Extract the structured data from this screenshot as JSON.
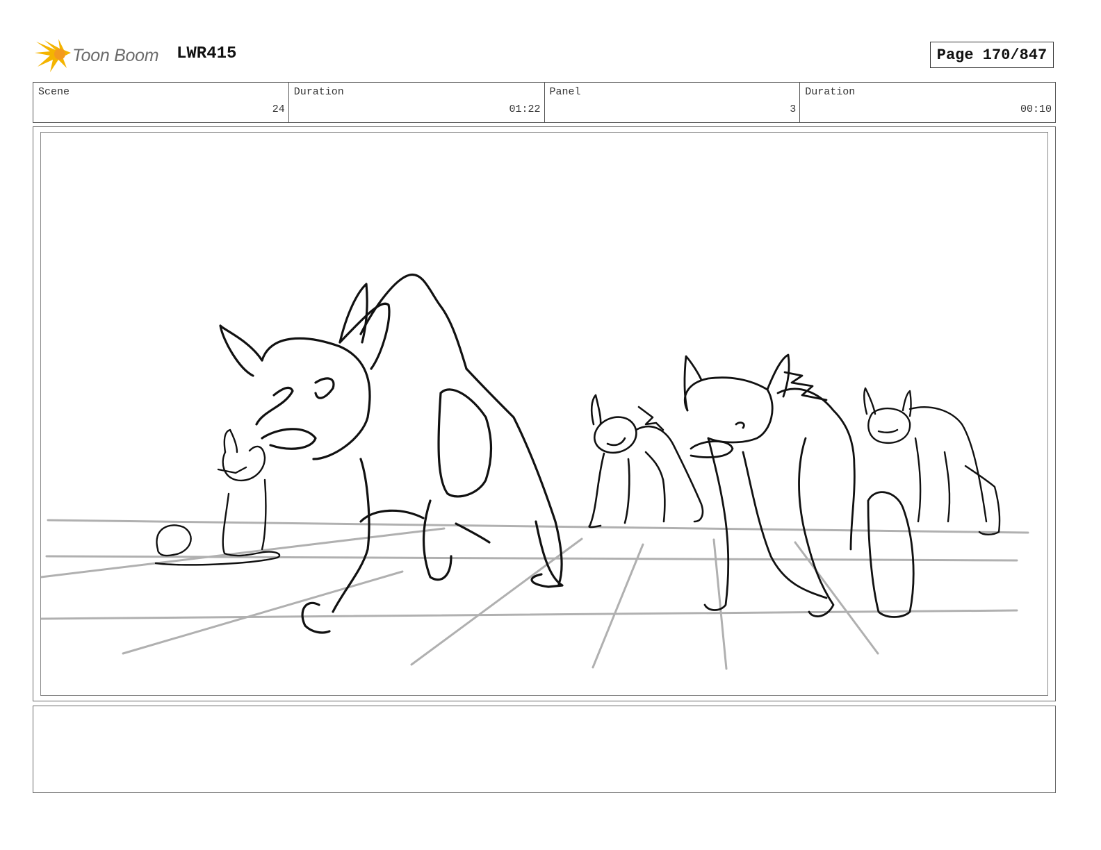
{
  "header": {
    "brand_name": "Toon Boom",
    "brand_icon": "toon-boom-logo-icon",
    "project_id": "LWR415",
    "page_label": "Page 170/847"
  },
  "meta": {
    "scene_label": "Scene",
    "scene_value": "24",
    "scene_duration_label": "Duration",
    "scene_duration_value": "01:22",
    "panel_label": "Panel",
    "panel_value": "3",
    "panel_duration_label": "Duration",
    "panel_duration_value": "00:10"
  },
  "panel": {
    "image_icon": "storyboard-sketch-icon"
  },
  "colors": {
    "brand_yellow": "#f4b400",
    "brand_orange": "#f39a1e",
    "sketch_ink": "#111111",
    "floor_grid": "#b0b0b0"
  },
  "notes": {
    "text": ""
  }
}
